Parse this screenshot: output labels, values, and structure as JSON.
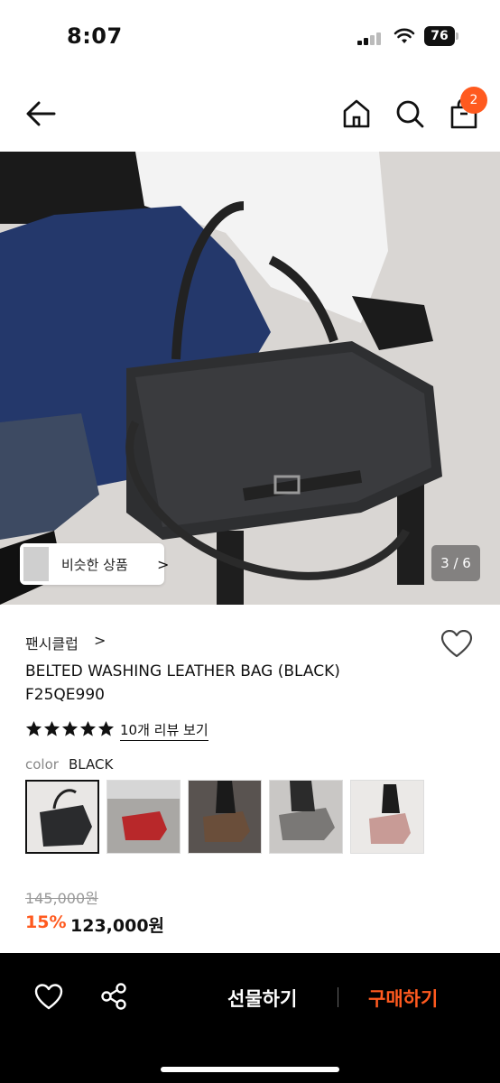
{
  "status_bar": {
    "time": "8:07",
    "battery": "76",
    "icons": [
      "signal-icon",
      "wifi-icon",
      "battery-icon"
    ]
  },
  "nav": {
    "icons": [
      "back-arrow-icon",
      "home-icon",
      "search-icon",
      "shopping-bag-icon"
    ],
    "cart_badge": "2"
  },
  "hero": {
    "similar_label": "비슷한 상품",
    "similar_chevron": ">",
    "page_counter": "3 / 6"
  },
  "product": {
    "brand": "팬시클럽",
    "brand_chevron": ">",
    "title_line1": "BELTED WASHING LEATHER BAG (BLACK)",
    "title_line2": "F25QE990",
    "rating_stars": 5,
    "review_link": "10개 리뷰 보기",
    "color_label": "color",
    "color_value": "BLACK",
    "swatches": [
      "black",
      "red",
      "brown",
      "grey",
      "pink"
    ],
    "original_price": "145,000원",
    "discount": "15%",
    "sale_price": "123,000원"
  },
  "bottom_bar": {
    "icons": [
      "heart-icon",
      "share-icon"
    ],
    "gift_label": "선물하기",
    "buy_label": "구매하기"
  },
  "colors": {
    "accent": "#ff5a1f",
    "bottom_bar_bg": "#000000"
  }
}
